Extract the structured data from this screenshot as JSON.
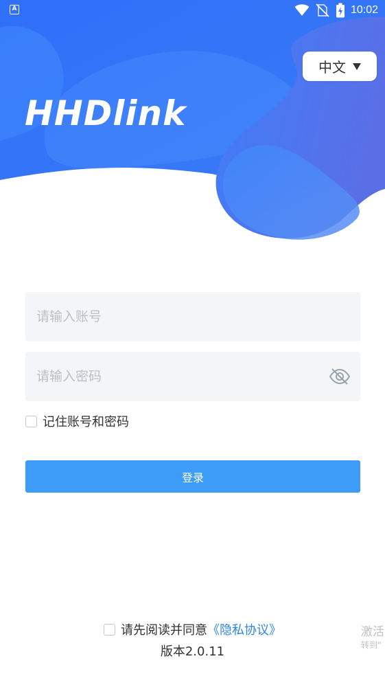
{
  "status_bar": {
    "app_icon_letter": "A",
    "time": "10:02",
    "icons": [
      "wifi-icon",
      "no-sim-icon",
      "battery-charging-icon"
    ]
  },
  "header": {
    "logo": "HHDlink",
    "language": {
      "label": "中文",
      "icon": "caret-down-icon"
    }
  },
  "form": {
    "account_placeholder": "请输入账号",
    "account_value": "",
    "password_placeholder": "请输入密码",
    "password_value": "",
    "password_toggle_icon": "eye-slash-icon",
    "remember_label": "记住账号和密码",
    "remember_checked": false,
    "login_label": "登录"
  },
  "footer": {
    "agree_text": "请先阅读并同意",
    "privacy_link": "《隐私协议》",
    "agree_checked": false,
    "version": "版本2.0.11"
  },
  "watermark": {
    "line1": "激活",
    "line2": "转到\""
  },
  "colors": {
    "brand_blue": "#3b7bf8",
    "button_blue": "#3d9cf7",
    "link_blue": "#2f86e8",
    "field_bg": "#f3f5f7",
    "placeholder": "#bcc0c6",
    "text": "#333333"
  }
}
